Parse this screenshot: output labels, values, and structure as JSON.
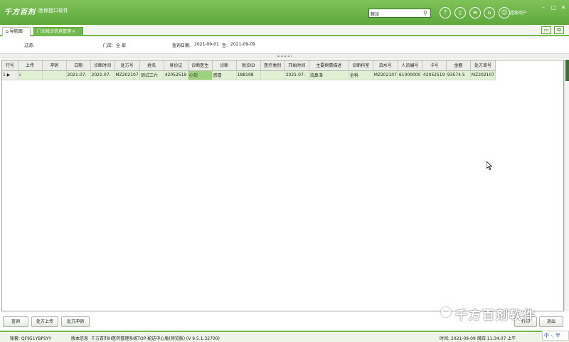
{
  "header": {
    "logo": "千方百剂",
    "subtitle": "医保接口软件",
    "search_value": "就诊",
    "username": "超级用户",
    "icons": [
      "help-icon",
      "mobile-icon",
      "document-icon",
      "lock-icon",
      "user-icon"
    ],
    "window_controls": [
      "–",
      "□",
      "✕"
    ]
  },
  "tabs": [
    {
      "label": "导航图",
      "icon": "home-icon",
      "active": false
    },
    {
      "label": "门诊就诊信息管理",
      "close": "×",
      "active": true
    }
  ],
  "filter": {
    "filter_label": "过滤:",
    "store_label": "门店:",
    "store_value": "全   部",
    "date_label": "查询日期:",
    "date_from": "2021-09-01",
    "date_to_label": "至:",
    "date_to": "2021-09-09"
  },
  "grid": {
    "columns": [
      "行号",
      "上传",
      "冲销",
      "日期",
      "诊断时间",
      "处方号",
      "姓名",
      "身份证",
      "诊断医生",
      "诊断",
      "就诊ID",
      "医疗类别",
      "开始时间",
      "主要病情描述",
      "诊断科室",
      "流水号",
      "人员编号",
      "卡号",
      "金额",
      "处方单号"
    ],
    "rows": [
      {
        "row_no": "1",
        "marker": "▶",
        "upload": "√",
        "reverse": "",
        "date": "2021-07-",
        "diag_time": "2021-07-",
        "rx_no": "MZ202107",
        "name": "测试三六",
        "id_card": "42052519",
        "doctor": "小刘",
        "diagnosis": "感冒",
        "visit_id": "188198",
        "med_type": "",
        "start_time": "2021-07-",
        "description": "流鼻涕",
        "dept": "全科",
        "serial_no": "MZ202107",
        "person_no": "61000000",
        "card_no": "42052519",
        "amount": "93574.5",
        "rx_order_no": "MZ202107"
      }
    ]
  },
  "buttons": {
    "query": "查询",
    "upload": "处方上传",
    "reverse": "处方冲销",
    "print": "打印",
    "exit": "退出"
  },
  "watermark": "千方百剂软件",
  "status": {
    "account": "账套: QF951YBPSYY",
    "version_label": "版本信息",
    "version": "千方百剂III医药管理系统TOP-配送中心版(预览版) (V 9.5.1.32700)",
    "time": "时间: 2021-09-09 周四 11:34.07 上午",
    "ime": "中 ·, 半"
  }
}
